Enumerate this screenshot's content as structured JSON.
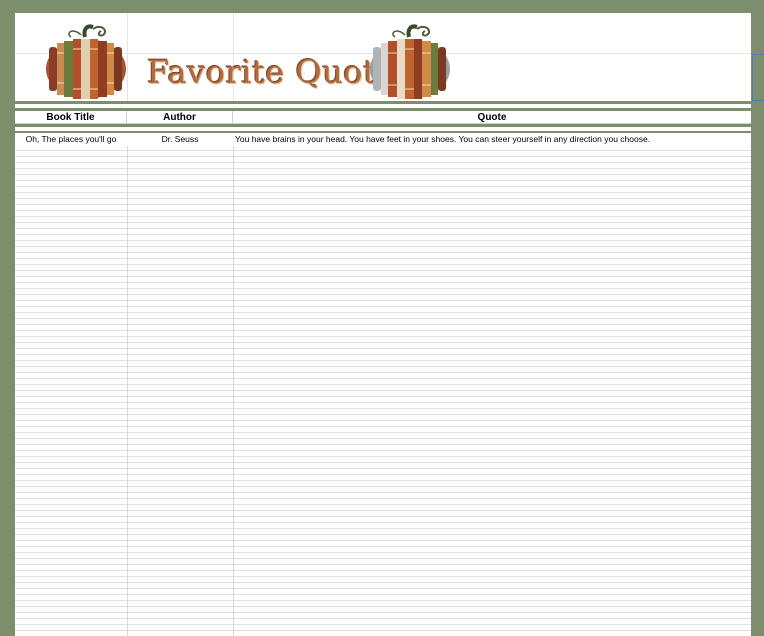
{
  "banner": {
    "title": "Favorite Quotes",
    "left_image": "pumpkin-books-icon",
    "right_image": "pumpkin-books-icon"
  },
  "table": {
    "headers": [
      "Book Title",
      "Author",
      "Quote"
    ],
    "rows": [
      {
        "book_title": "Oh, The places you'll go",
        "author": "Dr. Seuss",
        "quote": "You have brains in your head. You have feet in your shoes. You can steer yourself in any direction you choose."
      }
    ]
  },
  "colors": {
    "frame": "#7d8e6c",
    "title": "#b36a3c",
    "grid": "#e0e0e0"
  }
}
